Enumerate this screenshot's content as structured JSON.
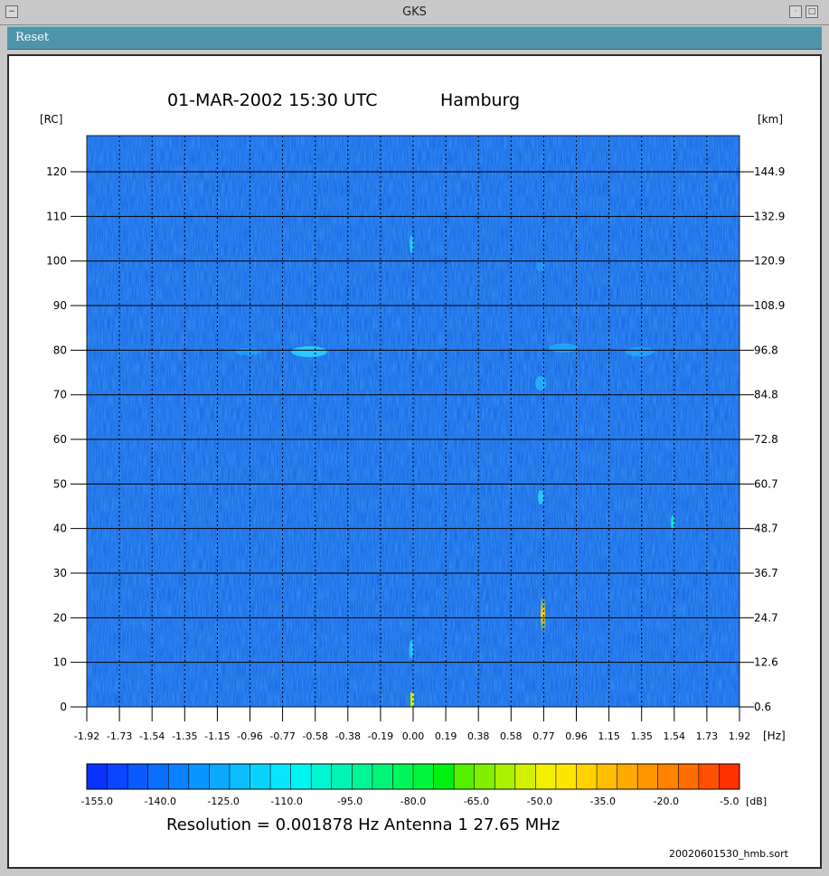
{
  "window": {
    "title": "GKS"
  },
  "menu": {
    "reset_label": "Reset"
  },
  "header": {
    "datetime": "01-MAR-2002 15:30 UTC",
    "station": "Hamburg"
  },
  "axes": {
    "left_unit": "[RC]",
    "right_unit": "[km]",
    "x_unit": "[Hz]",
    "colorbar_unit": "[dB]",
    "left_ticks": [
      "0",
      "10",
      "20",
      "30",
      "40",
      "50",
      "60",
      "70",
      "80",
      "90",
      "100",
      "110",
      "120"
    ],
    "right_ticks": [
      "0.6",
      "12.6",
      "24.7",
      "36.7",
      "48.7",
      "60.7",
      "72.8",
      "84.8",
      "96.8",
      "108.9",
      "120.9",
      "132.9",
      "144.9"
    ],
    "x_ticks": [
      "-1.92",
      "-1.73",
      "-1.54",
      "-1.35",
      "-1.15",
      "-0.96",
      "-0.77",
      "-0.58",
      "-0.38",
      "-0.19",
      "0.00",
      "0.19",
      "0.38",
      "0.58",
      "0.77",
      "0.96",
      "1.15",
      "1.35",
      "1.54",
      "1.73",
      "1.92"
    ],
    "colorbar_ticks": [
      "-155.0",
      "-140.0",
      "-125.0",
      "-110.0",
      "-95.0",
      "-80.0",
      "-65.0",
      "-50.0",
      "-35.0",
      "-20.0",
      "-5.0"
    ]
  },
  "colorbar_colors": [
    "#0a32ff",
    "#0a46ff",
    "#0a5aff",
    "#0a6eff",
    "#0a82ff",
    "#0a96ff",
    "#0aaaff",
    "#0abeff",
    "#0ad2ff",
    "#0ae6ff",
    "#00f5f0",
    "#00f5d2",
    "#00f5b4",
    "#00f596",
    "#00f578",
    "#00f55a",
    "#00f53c",
    "#00f010",
    "#55f000",
    "#80f000",
    "#aaf000",
    "#d2f000",
    "#f0f000",
    "#ffe600",
    "#ffd200",
    "#ffbe00",
    "#ffaa00",
    "#ff9600",
    "#ff8200",
    "#ff6e00",
    "#ff5000",
    "#ff3200"
  ],
  "info": {
    "resolution_text": "Resolution = 0.001878 Hz    Antenna  1     27.65 MHz"
  },
  "footer": {
    "filename": "20020601530_hmb.sort"
  },
  "colors": {
    "menubar": "#4f94a8",
    "plot_bg": "#1e6ee6",
    "frame_bg": "#ffffff"
  }
}
